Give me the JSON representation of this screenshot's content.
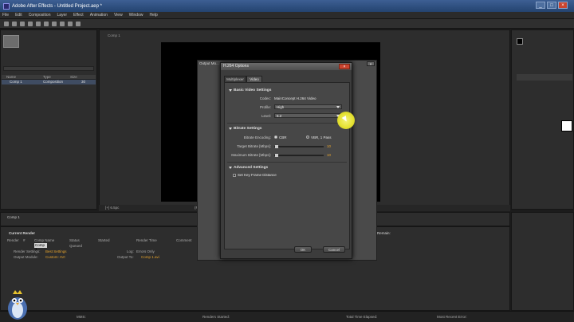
{
  "app": {
    "title": "Adobe After Effects - Untitled Project.aep *"
  },
  "menu": [
    "File",
    "Edit",
    "Composition",
    "Layer",
    "Effect",
    "Animation",
    "View",
    "Window",
    "Help"
  ],
  "project": {
    "columns": [
      "Name",
      "Type",
      "Size"
    ],
    "row": {
      "name": "Comp 1",
      "type": "Composition",
      "size": "30"
    }
  },
  "comp": {
    "tab": "Comp 1",
    "footer_label": "[+] 6.5pc",
    "footer_fit": "(Full)"
  },
  "ghost": {
    "title": "Output Mo..."
  },
  "dialog": {
    "title": "H.264 Options",
    "tabs": [
      "Multiplexer",
      "Video"
    ],
    "basic": {
      "header": "Basic Video Settings",
      "codec_label": "Codec:",
      "codec_value": "MainConcept H.264 Video",
      "profile_label": "Profile:",
      "profile_value": "High",
      "level_label": "Level:",
      "level_value": "5.2"
    },
    "bitrate": {
      "header": "Bitrate Settings",
      "encoding_label": "Bitrate Encoding:",
      "encoding_opt1": "CBR",
      "encoding_opt2": "VBR, 1 Pass",
      "target_label": "Target Bitrate [Mbps]:",
      "target_value": "10",
      "max_label": "Maximum Bitrate [Mbps]:",
      "max_value": "10"
    },
    "advanced": {
      "header": "Advanced Settings",
      "keyframe_label": "Set Key Frame Distance"
    },
    "ok": "OK",
    "cancel": "Cancel"
  },
  "render": {
    "header": "Current Render",
    "columns": [
      "Render",
      "#",
      "Comp Name",
      "Status",
      "Started",
      "Render Time",
      "Comment"
    ],
    "row_comp": "Comp 1",
    "row_status": "Queued",
    "render_settings_label": "Render Settings:",
    "render_settings_value": "Best Settings",
    "output_module_label": "Output Module:",
    "output_module_value": "Custom: AVI",
    "log_label": "Log:",
    "log_value": "Errors Only",
    "output_to_label": "Output To:",
    "output_to_value": "Comp 1.avi"
  },
  "timeline": {
    "label": "Comp 1"
  },
  "right": {
    "remain_label": "Remain:"
  },
  "status": {
    "msg": "MMS:",
    "renders": "Renders Started:",
    "elapsed": "Total Time Elapsed:",
    "recent": "Most Recent Error:"
  }
}
